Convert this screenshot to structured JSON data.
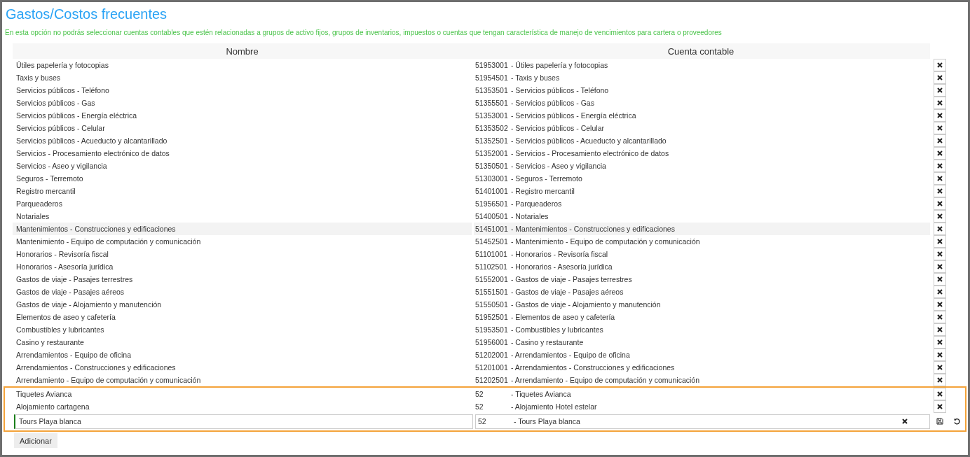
{
  "title": "Gastos/Costos frecuentes",
  "notice": "En esta opción no podrás seleccionar cuentas contables que estén relacionadas a grupos de activo fijos, grupos de inventarios, impuestos o cuentas que tengan característica de manejo de vencimientos para cartera o proveedores",
  "columns": [
    "Nombre",
    "Cuenta contable"
  ],
  "rows": [
    {
      "name": "Útiles papelería y fotocopias",
      "code": "51953001",
      "account": "- Útiles papelería y fotocopias",
      "hovered": false
    },
    {
      "name": "Taxis y buses",
      "code": "51954501",
      "account": "- Taxis y buses",
      "hovered": false
    },
    {
      "name": "Servicios públicos - Teléfono",
      "code": "51353501",
      "account": "- Servicios públicos - Teléfono",
      "hovered": false
    },
    {
      "name": "Servicios públicos - Gas",
      "code": "51355501",
      "account": "- Servicios públicos - Gas",
      "hovered": false
    },
    {
      "name": "Servicios públicos - Energía eléctrica",
      "code": "51353001",
      "account": "- Servicios públicos - Energía eléctrica",
      "hovered": false
    },
    {
      "name": "Servicios públicos - Celular",
      "code": "51353502",
      "account": "- Servicios públicos - Celular",
      "hovered": false
    },
    {
      "name": "Servicios públicos - Acueducto y alcantarillado",
      "code": "51352501",
      "account": "- Servicios públicos - Acueducto y alcantarillado",
      "hovered": false
    },
    {
      "name": "Servicios - Procesamiento electrónico de datos",
      "code": "51352001",
      "account": "- Servicios - Procesamiento electrónico de datos",
      "hovered": false
    },
    {
      "name": "Servicios - Aseo y vigilancia",
      "code": "51350501",
      "account": "- Servicios - Aseo y vigilancia",
      "hovered": false
    },
    {
      "name": "Seguros - Terremoto",
      "code": "51303001",
      "account": "- Seguros - Terremoto",
      "hovered": false
    },
    {
      "name": "Registro mercantil",
      "code": "51401001",
      "account": "- Registro mercantil",
      "hovered": false
    },
    {
      "name": "Parqueaderos",
      "code": "51956501",
      "account": "- Parqueaderos",
      "hovered": false
    },
    {
      "name": "Notariales",
      "code": "51400501",
      "account": "- Notariales",
      "hovered": false
    },
    {
      "name": "Mantenimientos - Construcciones y edificaciones",
      "code": "51451001",
      "account": "- Mantenimientos - Construcciones y edificaciones",
      "hovered": true
    },
    {
      "name": "Mantenimiento - Equipo de computación y comunicación",
      "code": "51452501",
      "account": "- Mantenimiento - Equipo de computación y comunicación",
      "hovered": false
    },
    {
      "name": "Honorarios - Revisoría fiscal",
      "code": "51101001",
      "account": "- Honorarios - Revisoría fiscal",
      "hovered": false
    },
    {
      "name": "Honorarios - Asesoría jurídica",
      "code": "51102501",
      "account": "- Honorarios - Asesoría jurídica",
      "hovered": false
    },
    {
      "name": "Gastos de viaje - Pasajes terrestres",
      "code": "51552001",
      "account": "- Gastos de viaje - Pasajes terrestres",
      "hovered": false
    },
    {
      "name": "Gastos de viaje - Pasajes aéreos",
      "code": "51551501",
      "account": "- Gastos de viaje - Pasajes aéreos",
      "hovered": false
    },
    {
      "name": "Gastos de viaje - Alojamiento y manutención",
      "code": "51550501",
      "account": "- Gastos de viaje - Alojamiento y manutención",
      "hovered": false
    },
    {
      "name": "Elementos de aseo y cafetería",
      "code": "51952501",
      "account": "- Elementos de aseo y cafetería",
      "hovered": false
    },
    {
      "name": "Combustibles y lubricantes",
      "code": "51953501",
      "account": "- Combustibles y lubricantes",
      "hovered": false
    },
    {
      "name": "Casino y restaurante",
      "code": "51956001",
      "account": "- Casino y restaurante",
      "hovered": false
    },
    {
      "name": "Arrendamientos - Equipo de oficina",
      "code": "51202001",
      "account": "- Arrendamientos - Equipo de oficina",
      "hovered": false
    },
    {
      "name": "Arrendamientos - Construcciones y edificaciones",
      "code": "51201001",
      "account": "- Arrendamientos - Construcciones y edificaciones",
      "hovered": false
    },
    {
      "name": "Arrendamiento - Equipo de computación y comunicación",
      "code": "51202501",
      "account": "- Arrendamiento - Equipo de computación y comunicación",
      "hovered": false
    }
  ],
  "new_rows": [
    {
      "name": "Tiquetes Avianca",
      "code": "52",
      "account": "- Tiquetes Avianca"
    },
    {
      "name": "Alojamiento cartagena",
      "code": "52",
      "account": "- Alojamiento Hotel estelar"
    }
  ],
  "editing_row": {
    "name": "Tours Playa blanca",
    "code": "52",
    "account": "- Tours Playa blanca"
  },
  "add_button": "Adicionar"
}
